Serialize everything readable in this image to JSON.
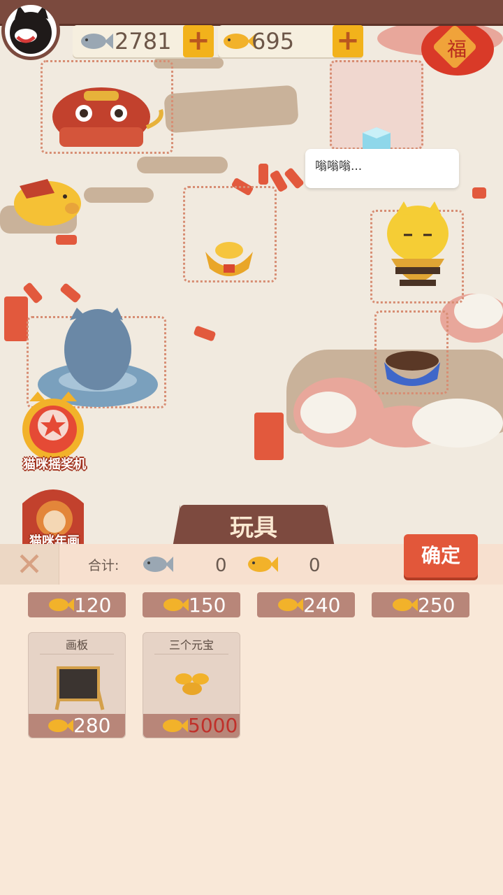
{
  "currency": {
    "silver_fish": "2781",
    "gold_fish": "695",
    "plus": "+"
  },
  "scene": {
    "speech_bubble": "嗡嗡嗡..."
  },
  "side_buttons": [
    {
      "label": "猫咪摇奖机"
    },
    {
      "label": "猫咪年画"
    }
  ],
  "panel": {
    "tab_title": "玩具",
    "close": "✕",
    "confirm_label": "确定",
    "sum_label": "合计:",
    "sum_silver": "0",
    "sum_gold": "0"
  },
  "toys_row1": [
    {
      "price": "120"
    },
    {
      "price": "150"
    },
    {
      "price": "240"
    },
    {
      "price": "250"
    }
  ],
  "toys_row2": [
    {
      "name": "画板",
      "price": "280",
      "price_color": "#ffffff"
    },
    {
      "name": "三个元宝",
      "price": "5000",
      "price_color": "#c0302a"
    }
  ]
}
